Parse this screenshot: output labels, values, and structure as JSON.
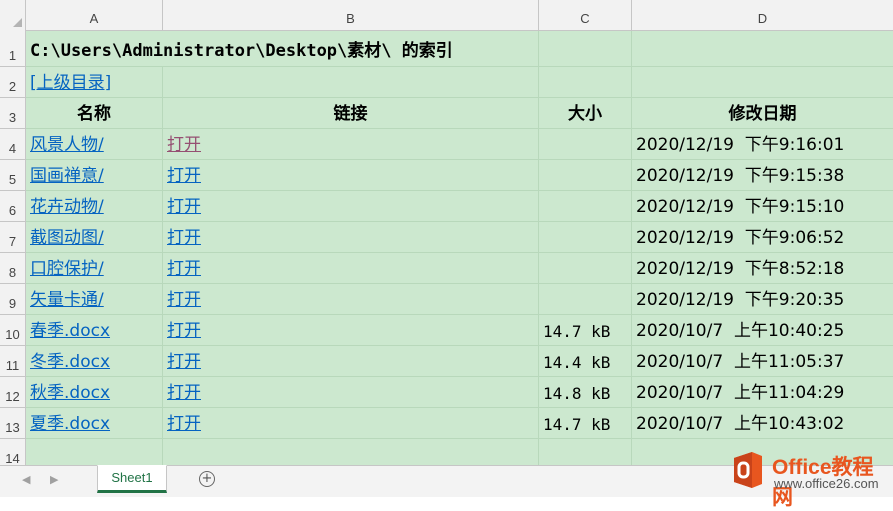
{
  "columns": [
    "A",
    "B",
    "C",
    "D"
  ],
  "rows": [
    "1",
    "2",
    "3",
    "4",
    "5",
    "6",
    "7",
    "8",
    "9",
    "10",
    "11",
    "12",
    "13",
    "14"
  ],
  "title": "C:\\Users\\Administrator\\Desktop\\素材\\ 的索引",
  "parent_link": "[上级目录]",
  "headers": {
    "name": "名称",
    "link": "链接",
    "size": "大小",
    "modified": "修改日期"
  },
  "items": [
    {
      "name": "风景人物/",
      "link": "打开",
      "visited": true,
      "size": "",
      "modified": "2020/12/19  下午9:16:01"
    },
    {
      "name": "国画禅意/",
      "link": "打开",
      "visited": false,
      "size": "",
      "modified": "2020/12/19  下午9:15:38"
    },
    {
      "name": "花卉动物/",
      "link": "打开",
      "visited": false,
      "size": "",
      "modified": "2020/12/19  下午9:15:10"
    },
    {
      "name": "截图动图/",
      "link": "打开",
      "visited": false,
      "size": "",
      "modified": "2020/12/19  下午9:06:52"
    },
    {
      "name": "口腔保护/",
      "link": "打开",
      "visited": false,
      "size": "",
      "modified": "2020/12/19  下午8:52:18"
    },
    {
      "name": "矢量卡通/",
      "link": "打开",
      "visited": false,
      "size": "",
      "modified": "2020/12/19  下午9:20:35"
    },
    {
      "name": "春季.docx",
      "link": "打开",
      "visited": false,
      "size": "14.7 kB",
      "modified": "2020/10/7  上午10:40:25"
    },
    {
      "name": "冬季.docx",
      "link": "打开",
      "visited": false,
      "size": "14.4 kB",
      "modified": "2020/10/7  上午11:05:37"
    },
    {
      "name": "秋季.docx",
      "link": "打开",
      "visited": false,
      "size": "14.8 kB",
      "modified": "2020/10/7  上午11:04:29"
    },
    {
      "name": "夏季.docx",
      "link": "打开",
      "visited": false,
      "size": "14.7 kB",
      "modified": "2020/10/7  上午10:43:02"
    }
  ],
  "sheet_tab": "Sheet1",
  "add_sheet_symbol": "+",
  "nav_prev": "◀",
  "nav_next": "▶",
  "watermark": {
    "brand": "Office教程网",
    "url": "www.office26.com"
  },
  "colors": {
    "grid_bg": "#cce8cf",
    "link": "#0563c1",
    "visited": "#954f72",
    "tab_accent": "#217346",
    "logo": "#e8561f"
  }
}
